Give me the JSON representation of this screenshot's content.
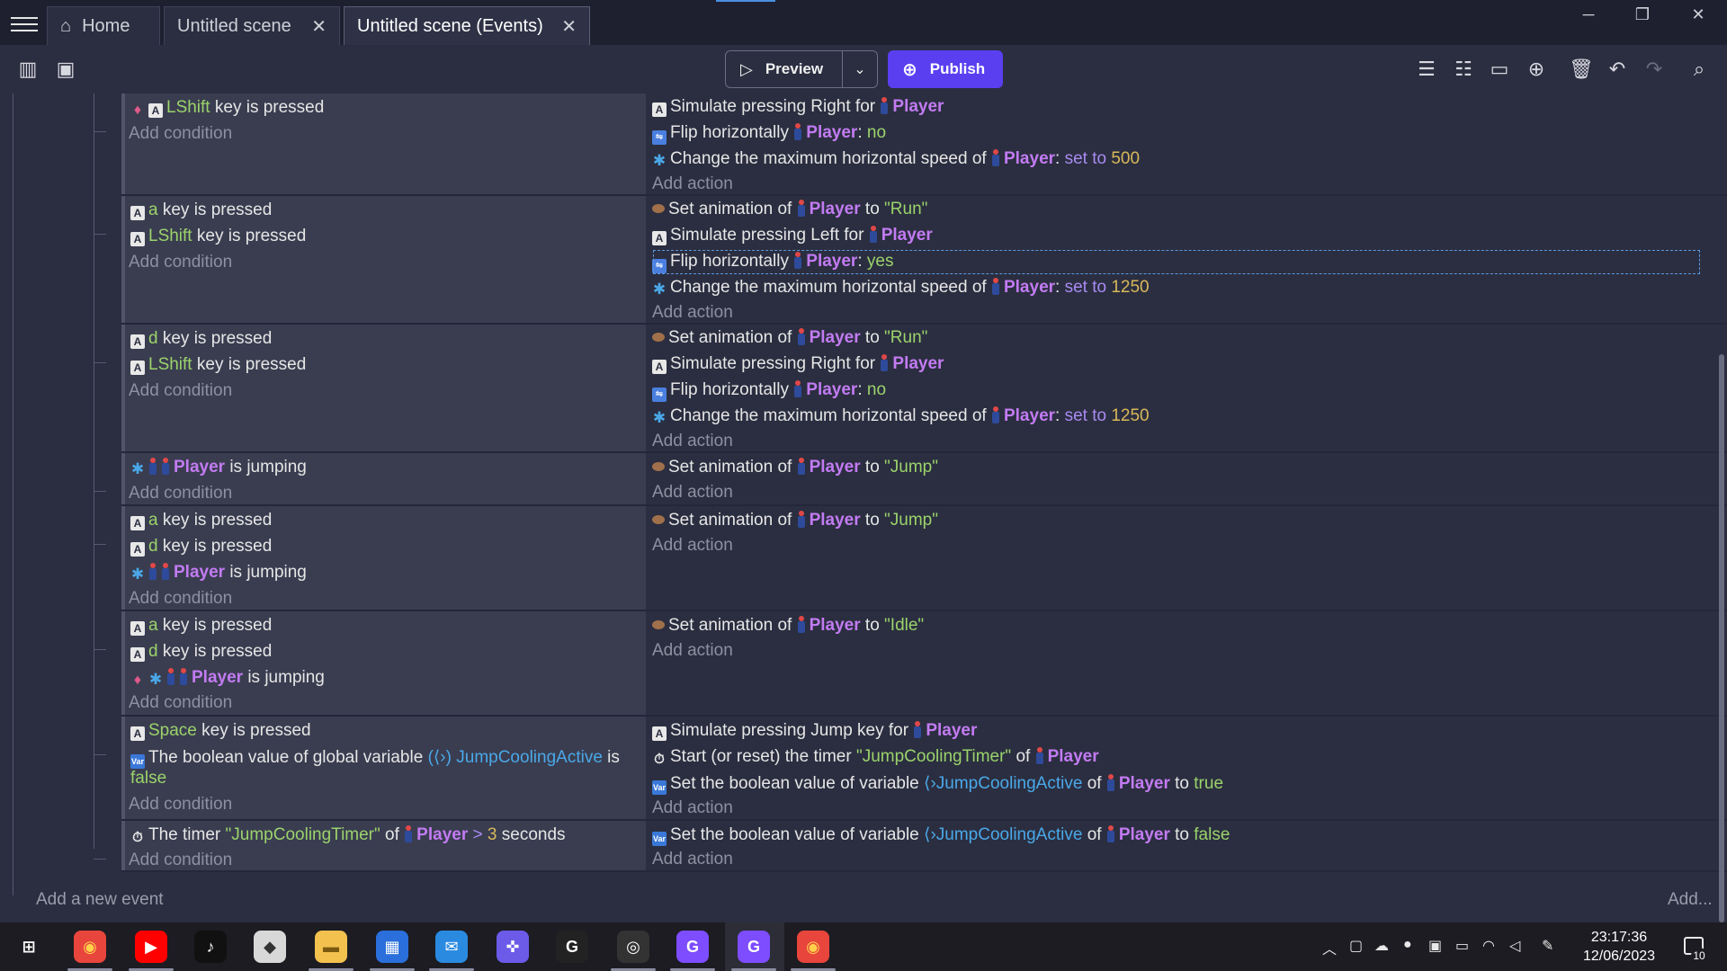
{
  "tabs": [
    {
      "label": "Home"
    },
    {
      "label": "Untitled scene"
    },
    {
      "label": "Untitled scene (Events)"
    }
  ],
  "toolbar": {
    "preview_label": "Preview",
    "publish_label": "Publish"
  },
  "events": [
    {
      "conditions": [
        {
          "parts": [
            {
              "t": "LShift",
              "c": "key"
            },
            {
              "t": " key is pressed"
            }
          ]
        },
        {
          "add": "Add condition"
        }
      ],
      "actions": [
        {
          "parts": [
            {
              "t": "Simulate pressing Right for "
            },
            {
              "t": "Player",
              "c": "obj"
            }
          ]
        },
        {
          "parts": [
            {
              "t": "Flip horizontally "
            },
            {
              "t": "Player",
              "c": "obj"
            },
            {
              "t": ": "
            },
            {
              "t": "no",
              "c": "bool"
            }
          ]
        },
        {
          "parts": [
            {
              "t": "Change the maximum horizontal speed of "
            },
            {
              "t": "Player",
              "c": "obj"
            },
            {
              "t": ": "
            },
            {
              "t": "set to",
              "c": "op"
            },
            {
              "t": " "
            },
            {
              "t": "500",
              "c": "num"
            }
          ]
        },
        {
          "add": "Add action"
        }
      ]
    },
    {
      "conditions": [
        {
          "parts": [
            {
              "t": "a",
              "c": "key"
            },
            {
              "t": " key is pressed"
            }
          ]
        },
        {
          "parts": [
            {
              "t": "LShift",
              "c": "key"
            },
            {
              "t": " key is pressed"
            }
          ]
        },
        {
          "add": "Add condition"
        }
      ],
      "actions": [
        {
          "parts": [
            {
              "t": "Set animation of "
            },
            {
              "t": "Player",
              "c": "obj"
            },
            {
              "t": " to "
            },
            {
              "t": "\"Run\"",
              "c": "str"
            }
          ]
        },
        {
          "parts": [
            {
              "t": "Simulate pressing Left for "
            },
            {
              "t": "Player",
              "c": "obj"
            }
          ]
        },
        {
          "parts": [
            {
              "t": "Flip horizontally "
            },
            {
              "t": "Player",
              "c": "obj"
            },
            {
              "t": ": "
            },
            {
              "t": "yes",
              "c": "bool"
            }
          ]
        },
        {
          "parts": [
            {
              "t": "Change the maximum horizontal speed of "
            },
            {
              "t": "Player",
              "c": "obj"
            },
            {
              "t": ": "
            },
            {
              "t": "set to",
              "c": "op"
            },
            {
              "t": " "
            },
            {
              "t": "1250",
              "c": "num"
            }
          ]
        },
        {
          "add": "Add action"
        }
      ]
    },
    {
      "conditions": [
        {
          "parts": [
            {
              "t": "d",
              "c": "key"
            },
            {
              "t": " key is pressed"
            }
          ]
        },
        {
          "parts": [
            {
              "t": "LShift",
              "c": "key"
            },
            {
              "t": " key is pressed"
            }
          ]
        },
        {
          "add": "Add condition"
        }
      ],
      "actions": [
        {
          "parts": [
            {
              "t": "Set animation of "
            },
            {
              "t": "Player",
              "c": "obj"
            },
            {
              "t": " to "
            },
            {
              "t": "\"Run\"",
              "c": "str"
            }
          ]
        },
        {
          "parts": [
            {
              "t": "Simulate pressing Right for "
            },
            {
              "t": "Player",
              "c": "obj"
            }
          ]
        },
        {
          "parts": [
            {
              "t": "Flip horizontally "
            },
            {
              "t": "Player",
              "c": "obj"
            },
            {
              "t": ": "
            },
            {
              "t": "no",
              "c": "bool"
            }
          ]
        },
        {
          "parts": [
            {
              "t": "Change the maximum horizontal speed of "
            },
            {
              "t": "Player",
              "c": "obj"
            },
            {
              "t": ": "
            },
            {
              "t": "set to",
              "c": "op"
            },
            {
              "t": " "
            },
            {
              "t": "1250",
              "c": "num"
            }
          ]
        },
        {
          "add": "Add action"
        }
      ]
    },
    {
      "conditions": [
        {
          "parts": [
            {
              "t": "Player",
              "c": "obj"
            },
            {
              "t": " is jumping"
            }
          ]
        },
        {
          "add": "Add condition"
        }
      ],
      "actions": [
        {
          "parts": [
            {
              "t": "Set animation of "
            },
            {
              "t": "Player",
              "c": "obj"
            },
            {
              "t": " to "
            },
            {
              "t": "\"Jump\"",
              "c": "str"
            }
          ]
        },
        {
          "add": "Add action"
        }
      ]
    },
    {
      "conditions": [
        {
          "parts": [
            {
              "t": "a",
              "c": "key"
            },
            {
              "t": " key is pressed"
            }
          ]
        },
        {
          "parts": [
            {
              "t": "d",
              "c": "key"
            },
            {
              "t": " key is pressed"
            }
          ]
        },
        {
          "parts": [
            {
              "t": "Player",
              "c": "obj"
            },
            {
              "t": " is jumping"
            }
          ]
        },
        {
          "add": "Add condition"
        }
      ],
      "actions": [
        {
          "parts": [
            {
              "t": "Set animation of "
            },
            {
              "t": "Player",
              "c": "obj"
            },
            {
              "t": " to "
            },
            {
              "t": "\"Jump\"",
              "c": "str"
            }
          ]
        },
        {
          "add": "Add action"
        }
      ]
    },
    {
      "conditions": [
        {
          "parts": [
            {
              "t": "a",
              "c": "key"
            },
            {
              "t": " key is pressed"
            }
          ]
        },
        {
          "parts": [
            {
              "t": "d",
              "c": "key"
            },
            {
              "t": " key is pressed"
            }
          ]
        },
        {
          "parts": [
            {
              "t": "Player",
              "c": "obj"
            },
            {
              "t": " is jumping"
            }
          ]
        },
        {
          "add": "Add condition"
        }
      ],
      "actions": [
        {
          "parts": [
            {
              "t": "Set animation of "
            },
            {
              "t": "Player",
              "c": "obj"
            },
            {
              "t": " to "
            },
            {
              "t": "\"Idle\"",
              "c": "str"
            }
          ]
        },
        {
          "add": "Add action"
        }
      ]
    },
    {
      "conditions": [
        {
          "parts": [
            {
              "t": "Space",
              "c": "key"
            },
            {
              "t": " key is pressed"
            }
          ]
        },
        {
          "parts": [
            {
              "t": "The boolean value of global variable "
            },
            {
              "t": "JumpCoolingActive",
              "c": "var"
            },
            {
              "t": " is"
            }
          ]
        },
        {
          "parts": [
            {
              "t": "false",
              "c": "bool"
            }
          ]
        },
        {
          "add": "Add condition"
        }
      ],
      "actions": [
        {
          "parts": [
            {
              "t": "Simulate pressing Jump key for "
            },
            {
              "t": "Player",
              "c": "obj"
            }
          ]
        },
        {
          "parts": [
            {
              "t": "Start (or reset) the timer "
            },
            {
              "t": "\"JumpCoolingTimer\"",
              "c": "str"
            },
            {
              "t": " of "
            },
            {
              "t": "Player",
              "c": "obj"
            }
          ]
        },
        {
          "parts": [
            {
              "t": "Set the boolean value of variable "
            },
            {
              "t": "JumpCoolingActive",
              "c": "var"
            },
            {
              "t": " of "
            },
            {
              "t": "Player",
              "c": "obj"
            },
            {
              "t": " to "
            },
            {
              "t": "true",
              "c": "bool"
            }
          ]
        },
        {
          "add": "Add action"
        }
      ]
    },
    {
      "conditions": [
        {
          "parts": [
            {
              "t": "The timer "
            },
            {
              "t": "\"JumpCoolingTimer\"",
              "c": "str"
            },
            {
              "t": " of "
            },
            {
              "t": "Player",
              "c": "obj"
            },
            {
              "t": " "
            },
            {
              "t": ">",
              "c": "op"
            },
            {
              "t": " "
            },
            {
              "t": "3",
              "c": "num"
            },
            {
              "t": " seconds"
            }
          ]
        },
        {
          "add": "Add condition"
        }
      ],
      "actions": [
        {
          "parts": [
            {
              "t": "Set the boolean value of variable "
            },
            {
              "t": "JumpCoolingActive",
              "c": "var"
            },
            {
              "t": " of "
            },
            {
              "t": "Player",
              "c": "obj"
            },
            {
              "t": " to "
            },
            {
              "t": "false",
              "c": "bool"
            }
          ]
        },
        {
          "add": "Add action"
        }
      ]
    }
  ],
  "footer": {
    "add_event": "Add a new event",
    "add_more": "Add..."
  },
  "clock": {
    "time": "23:17:36",
    "date": "12/06/2023"
  },
  "notifications": {
    "count": "10"
  },
  "taskbar": {
    "apps": [
      "start-icon",
      "chrome-icon",
      "youtube-icon",
      "tiktok-icon",
      "roblox-icon",
      "file-explorer-icon",
      "microsoft-store-icon",
      "mail-icon",
      "game-controller-icon",
      "logitech-g-icon",
      "obs-icon",
      "gdevelop-icon",
      "gdevelop-icon",
      "chrome-icon"
    ]
  }
}
